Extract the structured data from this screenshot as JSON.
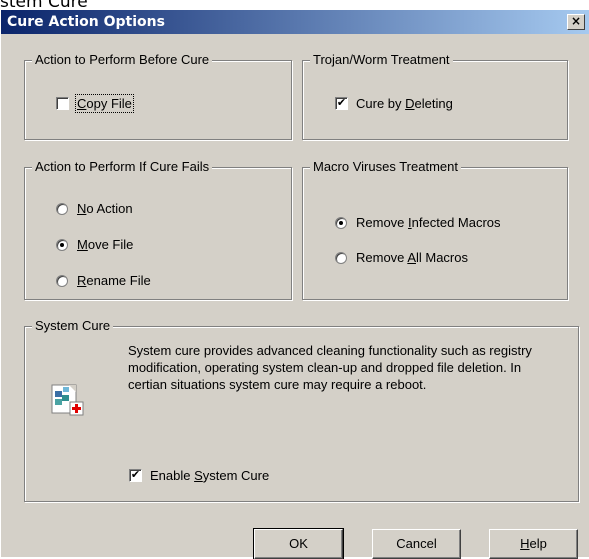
{
  "behind_text": "stem Cure",
  "window": {
    "title": "Cure Action Options",
    "close_glyph": "×"
  },
  "groups": {
    "before_cure": {
      "title": "Action to Perform Before Cure",
      "copy_file": {
        "pre": "",
        "accel": "C",
        "post": "opy File",
        "checked": false
      }
    },
    "trojan": {
      "title": "Trojan/Worm Treatment",
      "cure_deleting": {
        "pre": "Cure by ",
        "accel": "D",
        "post": "eleting",
        "checked": true
      }
    },
    "cure_fails": {
      "title": "Action to Perform If Cure Fails",
      "options": [
        {
          "pre": "",
          "accel": "N",
          "post": "o Action",
          "selected": false
        },
        {
          "pre": "",
          "accel": "M",
          "post": "ove File",
          "selected": true
        },
        {
          "pre": "",
          "accel": "R",
          "post": "ename File",
          "selected": false
        }
      ]
    },
    "macro": {
      "title": "Macro Viruses Treatment",
      "options": [
        {
          "pre": "Remove ",
          "accel": "I",
          "post": "nfected Macros",
          "selected": true
        },
        {
          "pre": "Remove ",
          "accel": "A",
          "post": "ll Macros",
          "selected": false
        }
      ]
    },
    "system_cure": {
      "title": "System Cure",
      "description": "System cure provides advanced cleaning functionality such as registry modification, operating system clean-up and dropped file deletion. In certian situations system cure may require a reboot.",
      "icon": "system-cure-icon",
      "enable": {
        "pre": "Enable ",
        "accel": "S",
        "post": "ystem Cure",
        "checked": true
      }
    }
  },
  "buttons": {
    "ok": "OK",
    "cancel": "Cancel",
    "help": {
      "pre": "",
      "accel": "H",
      "post": "elp"
    }
  },
  "check_glyph": "✔"
}
